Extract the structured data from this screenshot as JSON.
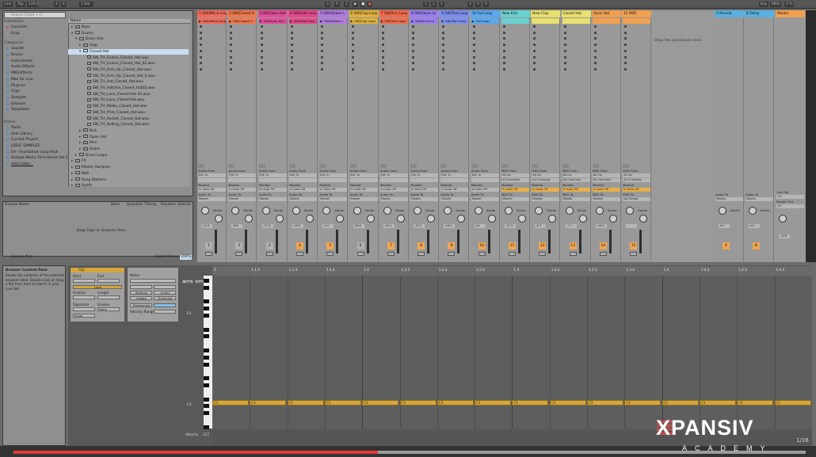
{
  "topbar": {
    "link": "Link",
    "tap": "Tap",
    "tempo": "120.00",
    "sig_num": "4",
    "sig_den": "4",
    "quant": "1 Bar",
    "pos1": "3",
    "pos2": "4",
    "pos3": "1",
    "loop1": "1",
    "loop2": "1",
    "loop3": "1",
    "len1": "4",
    "len2": "0",
    "len3": "0",
    "key": "Key",
    "midi": "MIDI",
    "cpu": "0 %"
  },
  "browser": {
    "search_placeholder": "Search (Cmd + F)",
    "collections_label": "Collections",
    "collections": [
      {
        "label": "Favorites",
        "color": "#d94848"
      },
      {
        "label": "Gray",
        "color": "#9c9c9c"
      }
    ],
    "categories_label": "Categories",
    "categories": [
      "Sounds",
      "Drums",
      "Instruments",
      "Audio Effects",
      "MIDI Effects",
      "Max for Live",
      "Plug-Ins",
      "Clips",
      "Samples",
      "Grooves",
      "Templates"
    ],
    "places_label": "Places",
    "places": [
      "Packs",
      "User Library",
      "Current Project",
      "LOGIC SAMPLES",
      "EA - Foundation Loop Pack",
      "Sample Works Tech House Vol.1",
      "Add Folder..."
    ],
    "name_header": "Name",
    "tree": [
      {
        "label": "Bass",
        "indent": 0,
        "open": false
      },
      {
        "label": "Drums",
        "indent": 0,
        "open": true
      },
      {
        "label": "Drum Hits",
        "indent": 1,
        "open": true
      },
      {
        "label": "Clap",
        "indent": 2,
        "open": false
      },
      {
        "label": "Closed Hat",
        "indent": 2,
        "open": true,
        "selected": true
      },
      {
        "label": "SW_TH_Evolve_Closed_Hat.wav",
        "indent": 3,
        "file": true
      },
      {
        "label": "SW_TH_Evolve_Closed_Hat_02.wav",
        "indent": 3,
        "file": true
      },
      {
        "label": "SW_TH_Firm_Up_Closed_Hat.wav",
        "indent": 3,
        "file": true
      },
      {
        "label": "SW_TH_Firm_Up_Closed_Hat_2.wav",
        "indent": 3,
        "file": true
      },
      {
        "label": "SW_TH_Hat_Closed_Hat.wav",
        "indent": 3,
        "file": true
      },
      {
        "label": "SW_TH_Hatchie_Closed_Hat02.wav",
        "indent": 3,
        "file": true
      },
      {
        "label": "SW_TH_Loco_Closed Hat 02.wav",
        "indent": 3,
        "file": true
      },
      {
        "label": "SW_TH_Loco_Closed Hat.wav",
        "indent": 3,
        "file": true
      },
      {
        "label": "SW_TH_Molko_Closed_Hat.wav",
        "indent": 3,
        "file": true
      },
      {
        "label": "SW_TH_Prim_Closed_Hat.wav",
        "indent": 3,
        "file": true
      },
      {
        "label": "SW_TH_Rocket_Closed_Hat.wav",
        "indent": 3,
        "file": true
      },
      {
        "label": "SW_TH_Rolling_Closed_Hat.wav",
        "indent": 3,
        "file": true
      },
      {
        "label": "Kick",
        "indent": 2,
        "open": false
      },
      {
        "label": "Open Hat",
        "indent": 2,
        "open": false
      },
      {
        "label": "Perc",
        "indent": 2,
        "open": false
      },
      {
        "label": "Snare",
        "indent": 2,
        "open": false
      },
      {
        "label": "Drum Loops",
        "indent": 1,
        "open": false
      },
      {
        "label": "FX",
        "indent": 0,
        "open": false
      },
      {
        "label": "Master Samples",
        "indent": 0,
        "open": false
      },
      {
        "label": "Midi",
        "indent": 0,
        "open": false
      },
      {
        "label": "Song Starters",
        "indent": 0,
        "open": false
      },
      {
        "label": "Synth",
        "indent": 0,
        "open": false
      }
    ]
  },
  "groove": {
    "headers": [
      "Groove Name",
      "Base",
      "Quantize",
      "Timing",
      "Random",
      "Velocity"
    ],
    "drop": "Drop Clips or Grooves Here",
    "global_label": "Global Amount",
    "global_value": "100%",
    "pool": "Groove Pool"
  },
  "tracks": [
    {
      "name": "1 SW(MKick Loop",
      "color": "#f06a5a",
      "clip": "SW(MKick Loop",
      "num": "1",
      "vol": "-14.3",
      "active": false
    },
    {
      "name": "2 SW(Closed H",
      "color": "#f0764a",
      "clip": "SW(Closed H",
      "num": "2",
      "vol": "-8.8",
      "active": false
    },
    {
      "name": "3 SW(Open Hat",
      "color": "#e24c9a",
      "clip": "SW(Open Hat",
      "num": "3",
      "vol": "-17.8",
      "active": false
    },
    {
      "name": "4 SW(Ride Loop",
      "color": "#e4478a",
      "clip": "SW(Ride Loop",
      "num": "4",
      "vol": "-16.9",
      "active": true
    },
    {
      "name": "5 SW(Shaker L",
      "color": "#b07ae0",
      "clip": "SW(Shaker L",
      "num": "5",
      "vol": "-9.4",
      "active": true
    },
    {
      "name": "6 SW(Clap Loop",
      "color": "#e0b03c",
      "clip": "SW(Clap Loop",
      "num": "6",
      "vol": "-18.6",
      "active": false
    },
    {
      "name": "7 SW(Perc Loop",
      "color": "#f26a4a",
      "clip": "SW(Perc Loop",
      "num": "7",
      "vol": "-16.5",
      "active": true
    },
    {
      "name": "8 SW(Snare Lo",
      "color": "#9a7ef0",
      "clip": "SW(Snare Lo",
      "num": "8",
      "vol": "-20.2",
      "active": true
    },
    {
      "name": "9 SW(Tom Loop",
      "color": "#7a8ef0",
      "clip": "SW(Tom Loop",
      "num": "9",
      "vol": "-16.4",
      "active": true
    },
    {
      "name": "10 Full Loop",
      "color": "#5aa8f0",
      "clip": "Full Loop",
      "num": "10",
      "vol": "-inf",
      "active": true
    },
    {
      "name": "New Kick",
      "color": "#6ad0d0",
      "clip": "",
      "num": "11",
      "vol": "-12.3",
      "active": true
    },
    {
      "name": "New Clap",
      "color": "#e8e070",
      "clip": "",
      "num": "12",
      "vol": "-6.7",
      "active": true
    },
    {
      "name": "Closed Hat",
      "color": "#e8e070",
      "clip": "",
      "num": "13",
      "vol": "-7.1",
      "active": true
    },
    {
      "name": "Open Hat",
      "color": "#f0a050",
      "clip": "",
      "num": "14",
      "vol": "-16.4",
      "active": true
    },
    {
      "name": "15 MIDI",
      "color": "#f0a050",
      "clip": "",
      "num": "15",
      "vol": "",
      "active": true
    }
  ],
  "returns": [
    {
      "name": "A Reverb",
      "color": "#5ab0e0",
      "num": "A",
      "vol": "-inf"
    },
    {
      "name": "B Delay",
      "color": "#5ab0e0",
      "num": "B",
      "vol": "-inf"
    }
  ],
  "master": {
    "name": "Master",
    "vol": "-10.8",
    "cue_out": "Cue Out",
    "cue_val": "1/2",
    "master_out": "Master Out",
    "master_val": "1/2"
  },
  "mixer_labels": {
    "audio_from": "Audio From",
    "midi_from": "MIDI From",
    "ext_in": "Ext. In",
    "all_ins": "All Ins",
    "all_channels": "All Channels",
    "monitor": "Monitor",
    "in": "In",
    "auto": "Auto",
    "off": "Off",
    "audio_to": "Audio To",
    "midi_to": "MIDI To",
    "master": "Master",
    "no_output": "No Output",
    "sends": "Sends"
  },
  "session": {
    "drop": "Drop Files and Devices Here"
  },
  "clipview": {
    "desc_title": "Browser Content Pane",
    "desc_text": "Shows the contents of the selected browser label. Double-click or drag a file from here to load it in your Live Set.",
    "clip_label": "Clip",
    "start": "Start",
    "end": "End",
    "loop": "Loop",
    "position": "Position",
    "length": "Length",
    "signature": "Signature",
    "groove": "Groove",
    "none": "None",
    "scale": "Scale",
    "notes_label": "Notes",
    "reverse": "Reverse",
    "invert": "Invert",
    "legato": "Legato",
    "duplicate": "Duplicate",
    "randomize": "Randomize",
    "velocity_range": "Velocity Range",
    "fold": "Fold",
    "scale_btn": "Scale",
    "c4": "C4",
    "c3": "C3",
    "velocity": "Velocity",
    "vel_val": "127",
    "ruler": [
      "1",
      "1.1.2",
      "1.1.3",
      "1.1.4",
      "1.2",
      "1.2.2",
      "1.2.3",
      "1.2.4",
      "1.3",
      "1.3.2",
      "1.3.3",
      "1.3.4",
      "1.4",
      "1.4.2",
      "1.4.3",
      "1.4.4"
    ],
    "note_label": "C3"
  },
  "watermark": {
    "brand": "XPANSIV",
    "sub": "ACADEMY",
    "page": "1/16",
    "progress": 0.46
  }
}
